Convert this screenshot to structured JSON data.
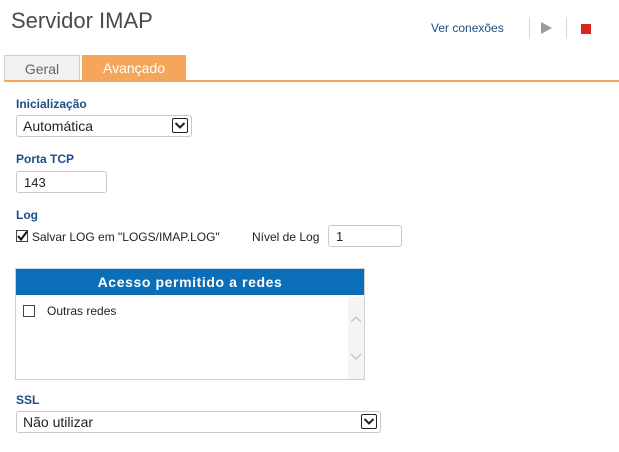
{
  "header": {
    "title": "Servidor IMAP",
    "view_connections_label": "Ver conexões"
  },
  "tabs": [
    {
      "label": "Geral",
      "active": false
    },
    {
      "label": "Avançado",
      "active": true
    }
  ],
  "form": {
    "startup": {
      "label": "Inicialização",
      "value": "Automática"
    },
    "tcp_port": {
      "label": "Porta TCP",
      "value": "143"
    },
    "log": {
      "label": "Log",
      "save_log_label": "Salvar LOG em \"LOGS/IMAP.LOG\"",
      "save_log_checked": true,
      "level_label": "Nível de Log",
      "level_value": "1"
    },
    "networks": {
      "header": "Acesso permitido a redes",
      "items": [
        {
          "label": "Outras redes",
          "checked": false
        }
      ]
    },
    "ssl": {
      "label": "SSL",
      "value": "Não utilizar"
    }
  },
  "colors": {
    "accent_orange": "#f6a65b",
    "link_blue": "#1c4e86",
    "panel_header_blue": "#0a6fb8",
    "stop_red": "#d9261c"
  },
  "icons": [
    "play-icon",
    "stop-icon",
    "chevron-down-icon",
    "chevron-up-icon",
    "check-icon"
  ]
}
